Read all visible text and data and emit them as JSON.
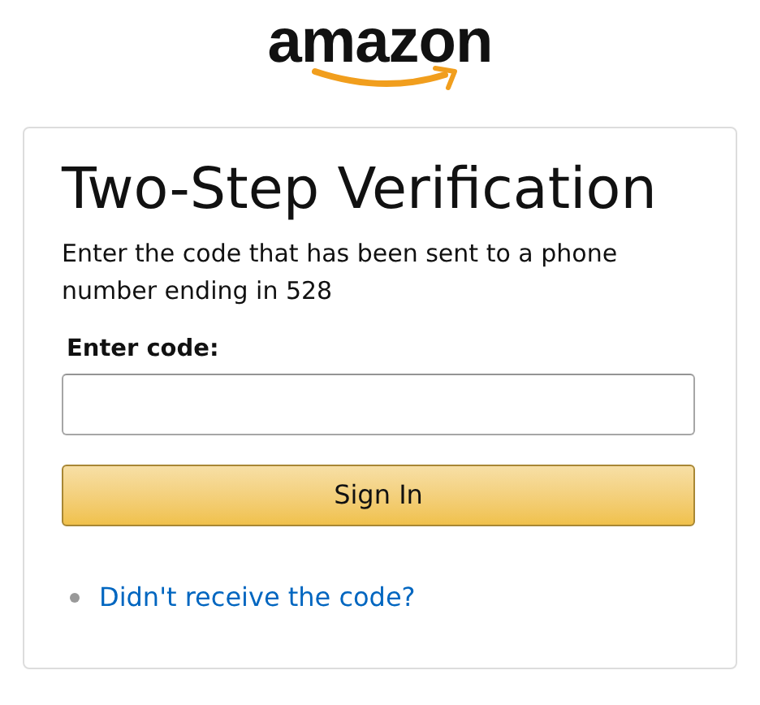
{
  "logo": {
    "text": "amazon"
  },
  "card": {
    "title": "Two-Step Verification",
    "description": "Enter the code that has been sent to a phone number ending in 528",
    "code_field": {
      "label": "Enter code:"
    },
    "submit_button": {
      "label": "Sign In"
    },
    "links": [
      {
        "label": "Didn't receive the code?"
      }
    ]
  }
}
